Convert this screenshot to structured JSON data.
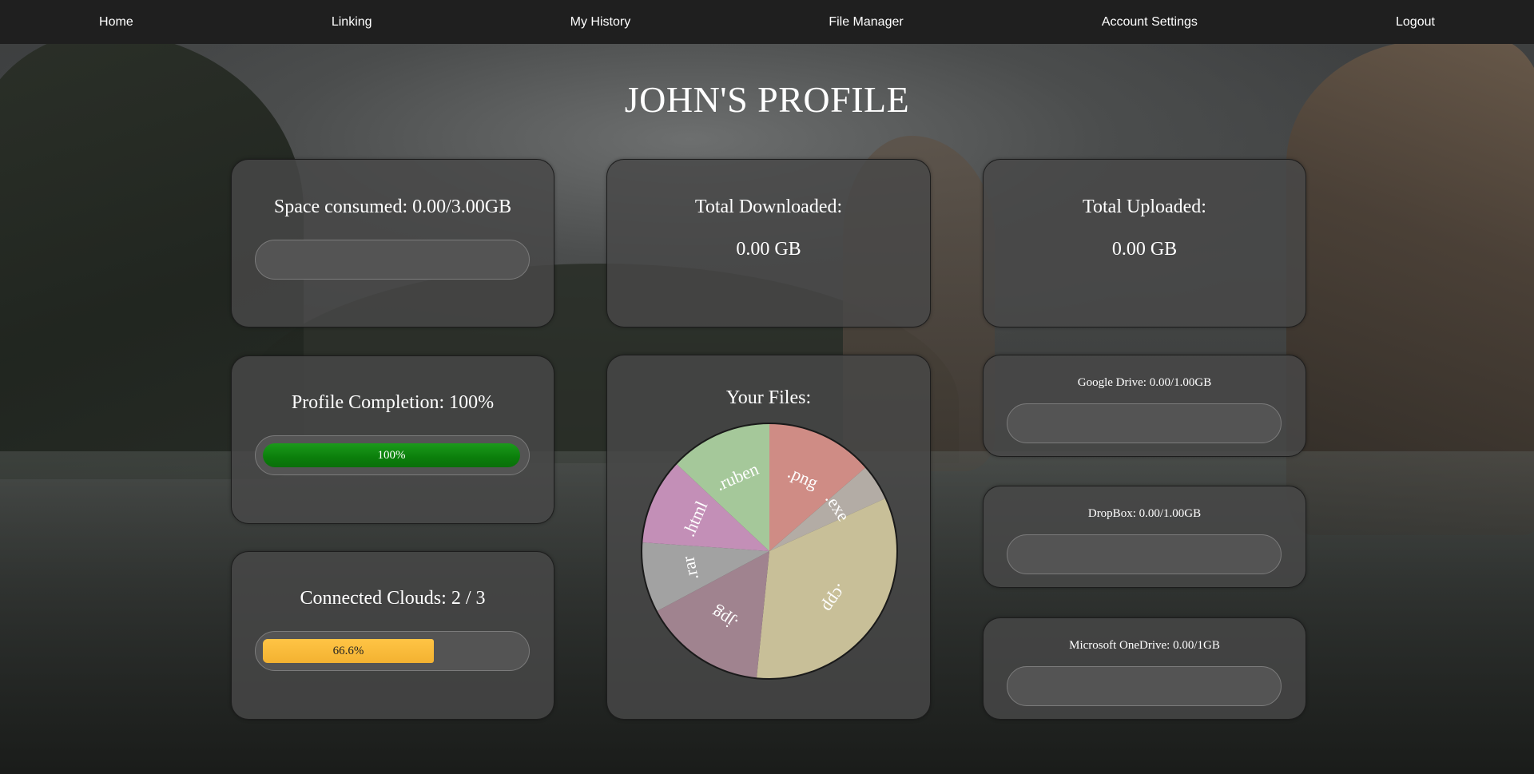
{
  "nav": {
    "items": [
      {
        "label": "Home"
      },
      {
        "label": "Linking"
      },
      {
        "label": "My History"
      },
      {
        "label": "File Manager"
      },
      {
        "label": "Account Settings"
      },
      {
        "label": "Logout"
      }
    ]
  },
  "page": {
    "title": "JOHN'S PROFILE"
  },
  "space": {
    "label": "Space consumed: 0.00/3.00GB",
    "percent": 0
  },
  "downloaded": {
    "label": "Total Downloaded:",
    "value": "0.00 GB"
  },
  "uploaded": {
    "label": "Total Uploaded:",
    "value": "0.00 GB"
  },
  "profile_completion": {
    "label": "Profile Completion: 100%",
    "bar_text": "100%",
    "percent": 100,
    "color": "#0b7e0b"
  },
  "clouds": {
    "label": "Connected Clouds: 2 / 3",
    "bar_text": "66.6%",
    "percent": 66.6,
    "color": "#f3b231"
  },
  "files": {
    "label": "Your Files:"
  },
  "storage": {
    "google_drive": {
      "label": "Google Drive: 0.00/1.00GB",
      "percent": 0
    },
    "dropbox": {
      "label": "DropBox: 0.00/1.00GB",
      "percent": 0
    },
    "onedrive": {
      "label": "Microsoft OneDrive: 0.00/1GB",
      "percent": 0
    }
  },
  "chart_data": {
    "type": "pie",
    "title": "Your Files:",
    "labels": [
      ".png",
      ".exe",
      ".cpp",
      ".jpg",
      ".rar",
      ".html",
      ".ruben"
    ],
    "values": [
      13.6,
      4.6,
      33.4,
      15.6,
      8.9,
      10.9,
      13.0
    ],
    "colors": [
      "#cf8c85",
      "#b3aca5",
      "#c8bf98",
      "#a0838f",
      "#a2a2a2",
      "#c38fb7",
      "#a5c89a"
    ],
    "label_color": "#ffffff"
  }
}
